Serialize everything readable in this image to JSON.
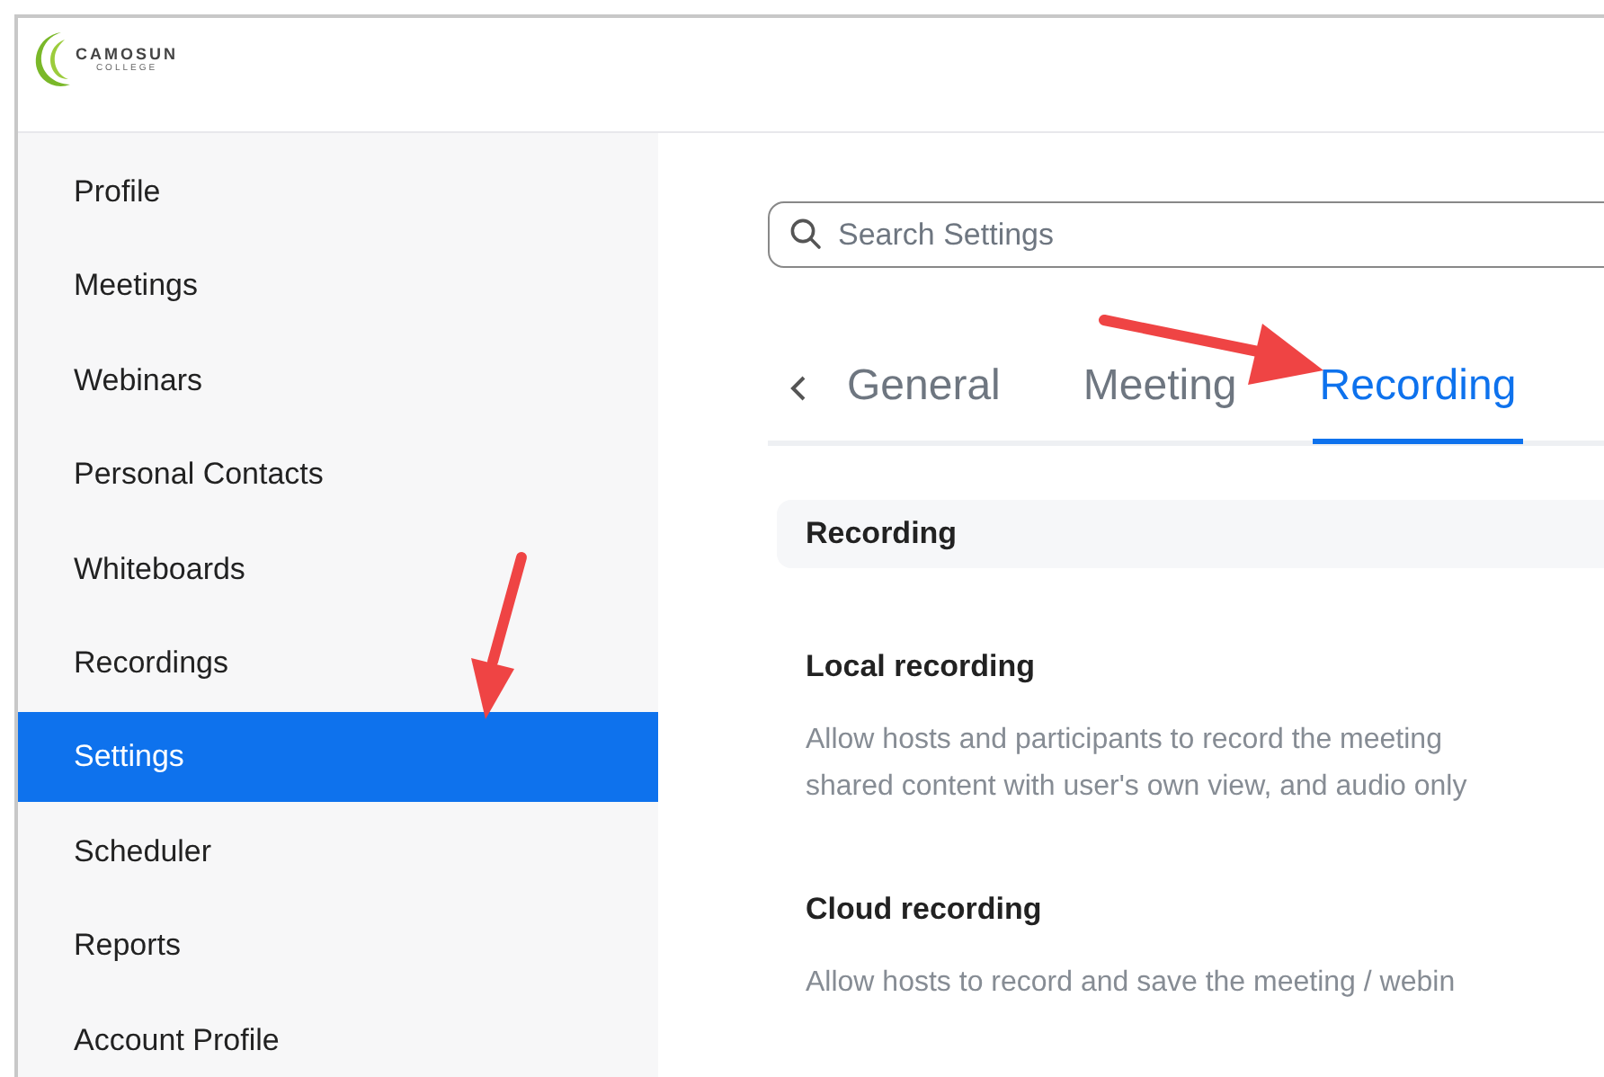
{
  "logo": {
    "name": "CAMOSUN",
    "subtitle": "COLLEGE"
  },
  "sidebar": {
    "items": [
      {
        "label": "Profile",
        "selected": false
      },
      {
        "label": "Meetings",
        "selected": false
      },
      {
        "label": "Webinars",
        "selected": false
      },
      {
        "label": "Personal Contacts",
        "selected": false
      },
      {
        "label": "Whiteboards",
        "selected": false
      },
      {
        "label": "Recordings",
        "selected": false
      },
      {
        "label": "Settings",
        "selected": true
      },
      {
        "label": "Scheduler",
        "selected": false
      },
      {
        "label": "Reports",
        "selected": false
      },
      {
        "label": "Account Profile",
        "selected": false
      }
    ]
  },
  "search": {
    "placeholder": "Search Settings"
  },
  "tabs": [
    {
      "label": "General",
      "selected": false
    },
    {
      "label": "Meeting",
      "selected": false
    },
    {
      "label": "Recording",
      "selected": true
    }
  ],
  "section": {
    "title": "Recording",
    "settings": [
      {
        "title": "Local recording",
        "description": [
          "Allow hosts and participants to record the meeting",
          "shared content with user's own view, and audio only"
        ]
      },
      {
        "title": "Cloud recording",
        "description": [
          "Allow hosts to record and save the meeting / webin"
        ]
      }
    ]
  }
}
